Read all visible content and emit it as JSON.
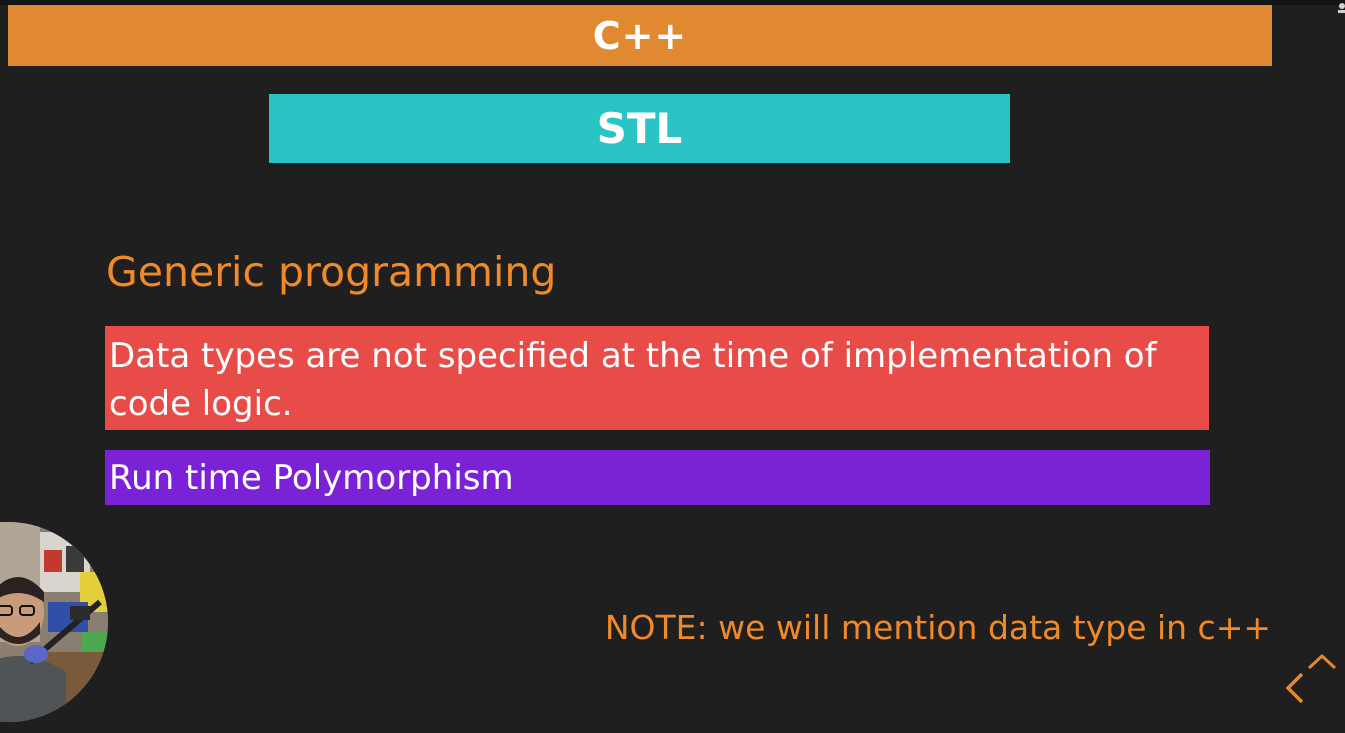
{
  "slide": {
    "title": "C++",
    "subtitle": "STL",
    "heading": "Generic programming",
    "definition": "Data types are not specified at the time of implementation of code logic.",
    "contrast": "Run time Polymorphism",
    "note": "NOTE: we will mention data type in c++"
  },
  "colors": {
    "background": "#1f1f1f",
    "title_bar": "#e08930",
    "subtitle_bar": "#2bc4c4",
    "heading_text": "#f0892a",
    "definition_box": "#e84c48",
    "contrast_box": "#7b22d6",
    "note_text": "#f0892a"
  },
  "icons": {
    "previous": "chevron-left-icon",
    "up": "chevron-up-icon"
  }
}
